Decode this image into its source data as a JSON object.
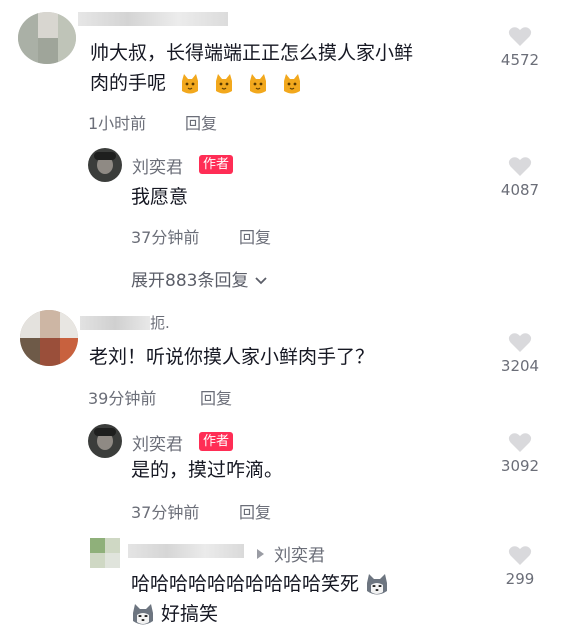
{
  "comments": [
    {
      "text_line1": "帅大叔，长得端端正正怎么摸人家小鲜",
      "text_line2": "肉的手呢",
      "emoji": "cat-face-emoji",
      "time": "1小时前",
      "reply": "回复",
      "likes": "4572",
      "reply_item": {
        "name": "刘奕君",
        "tag": "作者",
        "text": "我愿意",
        "time": "37分钟前",
        "reply": "回复",
        "likes": "4087"
      },
      "expand": "展开883条回复"
    },
    {
      "name_suffix": "扼.",
      "text": "老刘！听说你摸人家小鲜肉手了？",
      "time": "39分钟前",
      "reply": "回复",
      "likes": "3204",
      "replies": [
        {
          "name": "刘奕君",
          "tag": "作者",
          "text": "是的，摸过咋滴。",
          "time": "37分钟前",
          "reply": "回复",
          "likes": "3092"
        },
        {
          "reply_to": "刘奕君",
          "text_line1": "哈哈哈哈哈哈哈哈哈哈笑死",
          "text_line2": "好搞笑",
          "emoji": "husky-face-emoji",
          "likes": "299"
        }
      ]
    }
  ],
  "colors": {
    "author_tag": "#ff2d55",
    "secondary_text": "#6b6e78",
    "primary_text": "#161823"
  }
}
